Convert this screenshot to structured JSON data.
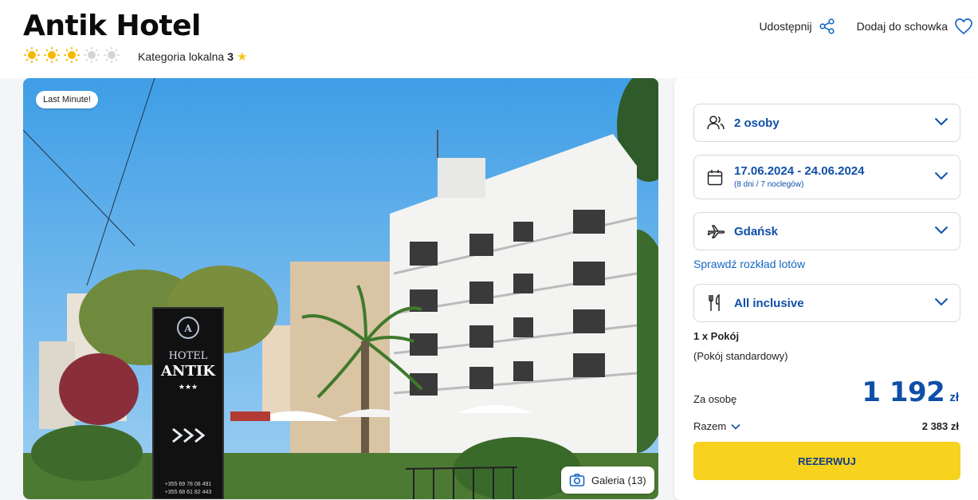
{
  "hotel": {
    "name": "Antik Hotel",
    "stars_filled": 3,
    "stars_total": 5,
    "category_label": "Kategoria lokalna",
    "category_value": "3"
  },
  "actions": {
    "share_label": "Udostępnij",
    "favorite_label": "Dodaj do schowka"
  },
  "photo": {
    "badge": "Last Minute!",
    "gallery_label": "Galeria (13)",
    "sign_line1": "HOTEL",
    "sign_line2": "ANTIK",
    "sign_stars": "★★★",
    "sign_phone1": "+355 69 78 08 491",
    "sign_phone2": "+355 68 61 82 443"
  },
  "booking": {
    "persons": "2 osoby",
    "dates": "17.06.2024 - 24.06.2024",
    "dates_sub": "(8 dni / 7 noclegów)",
    "departure": "Gdańsk",
    "flights_link": "Sprawdź rozkład lotów",
    "board": "All inclusive",
    "room_count": "1 x Pokój",
    "room_type": "(Pokój standardowy)",
    "per_person_label": "Za osobę",
    "per_person_price": "1 192",
    "currency": "zł",
    "total_label": "Razem",
    "total_value": "2 383 zł",
    "reserve_label": "REZERWUJ"
  },
  "colors": {
    "accent": "#0f4fa8",
    "button": "#f7d21e",
    "sun": "#f5b800"
  }
}
